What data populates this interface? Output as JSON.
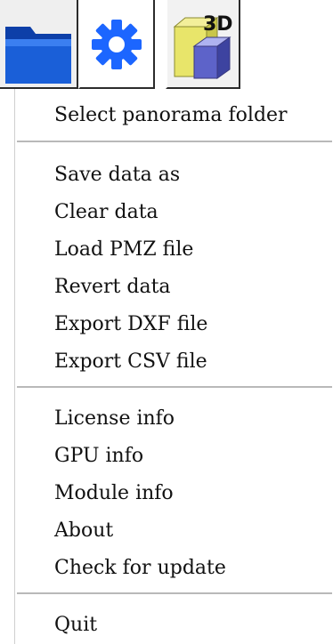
{
  "toolbar": {
    "buttons": [
      {
        "icon": "folder-icon"
      },
      {
        "icon": "gear-icon"
      },
      {
        "icon": "3d-view-icon",
        "badge": "3D"
      }
    ]
  },
  "menu": {
    "groups": [
      [
        "Select panorama folder"
      ],
      [
        "Save data as",
        "Clear data",
        "Load PMZ file",
        "Revert data",
        "Export DXF file",
        "Export CSV file"
      ],
      [
        "License info",
        "GPU info",
        "Module info",
        "About",
        "Check for update"
      ],
      [
        "Quit"
      ]
    ]
  },
  "colors": {
    "folder_blue": "#1a5fd8",
    "gear_blue": "#1c66ff",
    "cube_yellow": "#e8e56a",
    "cube_blue": "#5d63c9",
    "separator": "#b9b9b9"
  }
}
